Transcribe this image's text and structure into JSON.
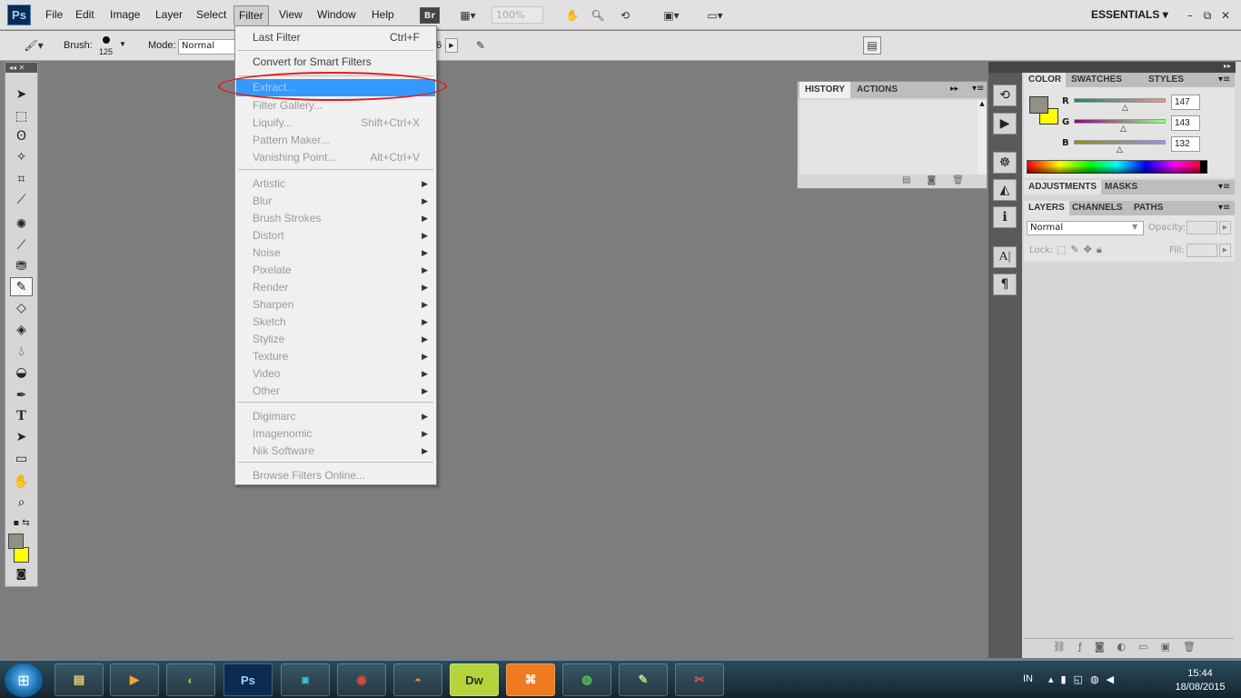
{
  "app": {
    "logo": "Ps",
    "workspace": "ESSENTIALS"
  },
  "menubar": {
    "items": [
      "File",
      "Edit",
      "Image",
      "Layer",
      "Select",
      "Filter",
      "View",
      "Window",
      "Help"
    ],
    "bridge": "Br",
    "zoom": "100%",
    "window_controls": {
      "minimize": "–",
      "restore": "⧉",
      "close": "✕"
    }
  },
  "options": {
    "brush_label": "Brush:",
    "brush_size": "125",
    "mode_label": "Mode:",
    "mode_value": "Normal",
    "partial_value": "6"
  },
  "filter_menu": {
    "last_filter": {
      "label": "Last Filter",
      "shortcut": "Ctrl+F"
    },
    "convert": "Convert for Smart Filters",
    "extract": "Extract...",
    "filter_gallery": "Filter Gallery...",
    "liquify": {
      "label": "Liquify...",
      "shortcut": "Shift+Ctrl+X"
    },
    "pattern_maker": "Pattern Maker...",
    "vanishing_point": {
      "label": "Vanishing Point...",
      "shortcut": "Alt+Ctrl+V"
    },
    "submenus": [
      "Artistic",
      "Blur",
      "Brush Strokes",
      "Distort",
      "Noise",
      "Pixelate",
      "Render",
      "Sharpen",
      "Sketch",
      "Stylize",
      "Texture",
      "Video",
      "Other"
    ],
    "plugins": [
      "Digimarc",
      "Imagenomic",
      "Nik Software"
    ],
    "browse": "Browse Filters Online..."
  },
  "history_panel": {
    "tabs": [
      "HISTORY",
      "ACTIONS"
    ]
  },
  "color_panel": {
    "tabs": [
      "COLOR",
      "SWATCHES",
      "STYLES"
    ],
    "r": {
      "label": "R",
      "value": "147"
    },
    "g": {
      "label": "G",
      "value": "143"
    },
    "b": {
      "label": "B",
      "value": "132"
    },
    "foreground": "#938f84",
    "background": "#ffff00"
  },
  "adjust_panel": {
    "tabs": [
      "ADJUSTMENTS",
      "MASKS"
    ]
  },
  "layers_panel": {
    "tabs": [
      "LAYERS",
      "CHANNELS",
      "PATHS"
    ],
    "blend": "Normal",
    "opacity_label": "Opacity:",
    "lock_label": "Lock:",
    "fill_label": "Fill:"
  },
  "taskbar": {
    "apps": [
      "Explorer",
      "Media",
      "CorelDraw",
      "Ps",
      "JPG",
      "Chrome",
      "Firefox",
      "Dw",
      "XAMPP",
      "Globe",
      "Notepad++",
      "Snipping"
    ],
    "lang": "IN",
    "time": "15:44",
    "date": "18/08/2015"
  }
}
